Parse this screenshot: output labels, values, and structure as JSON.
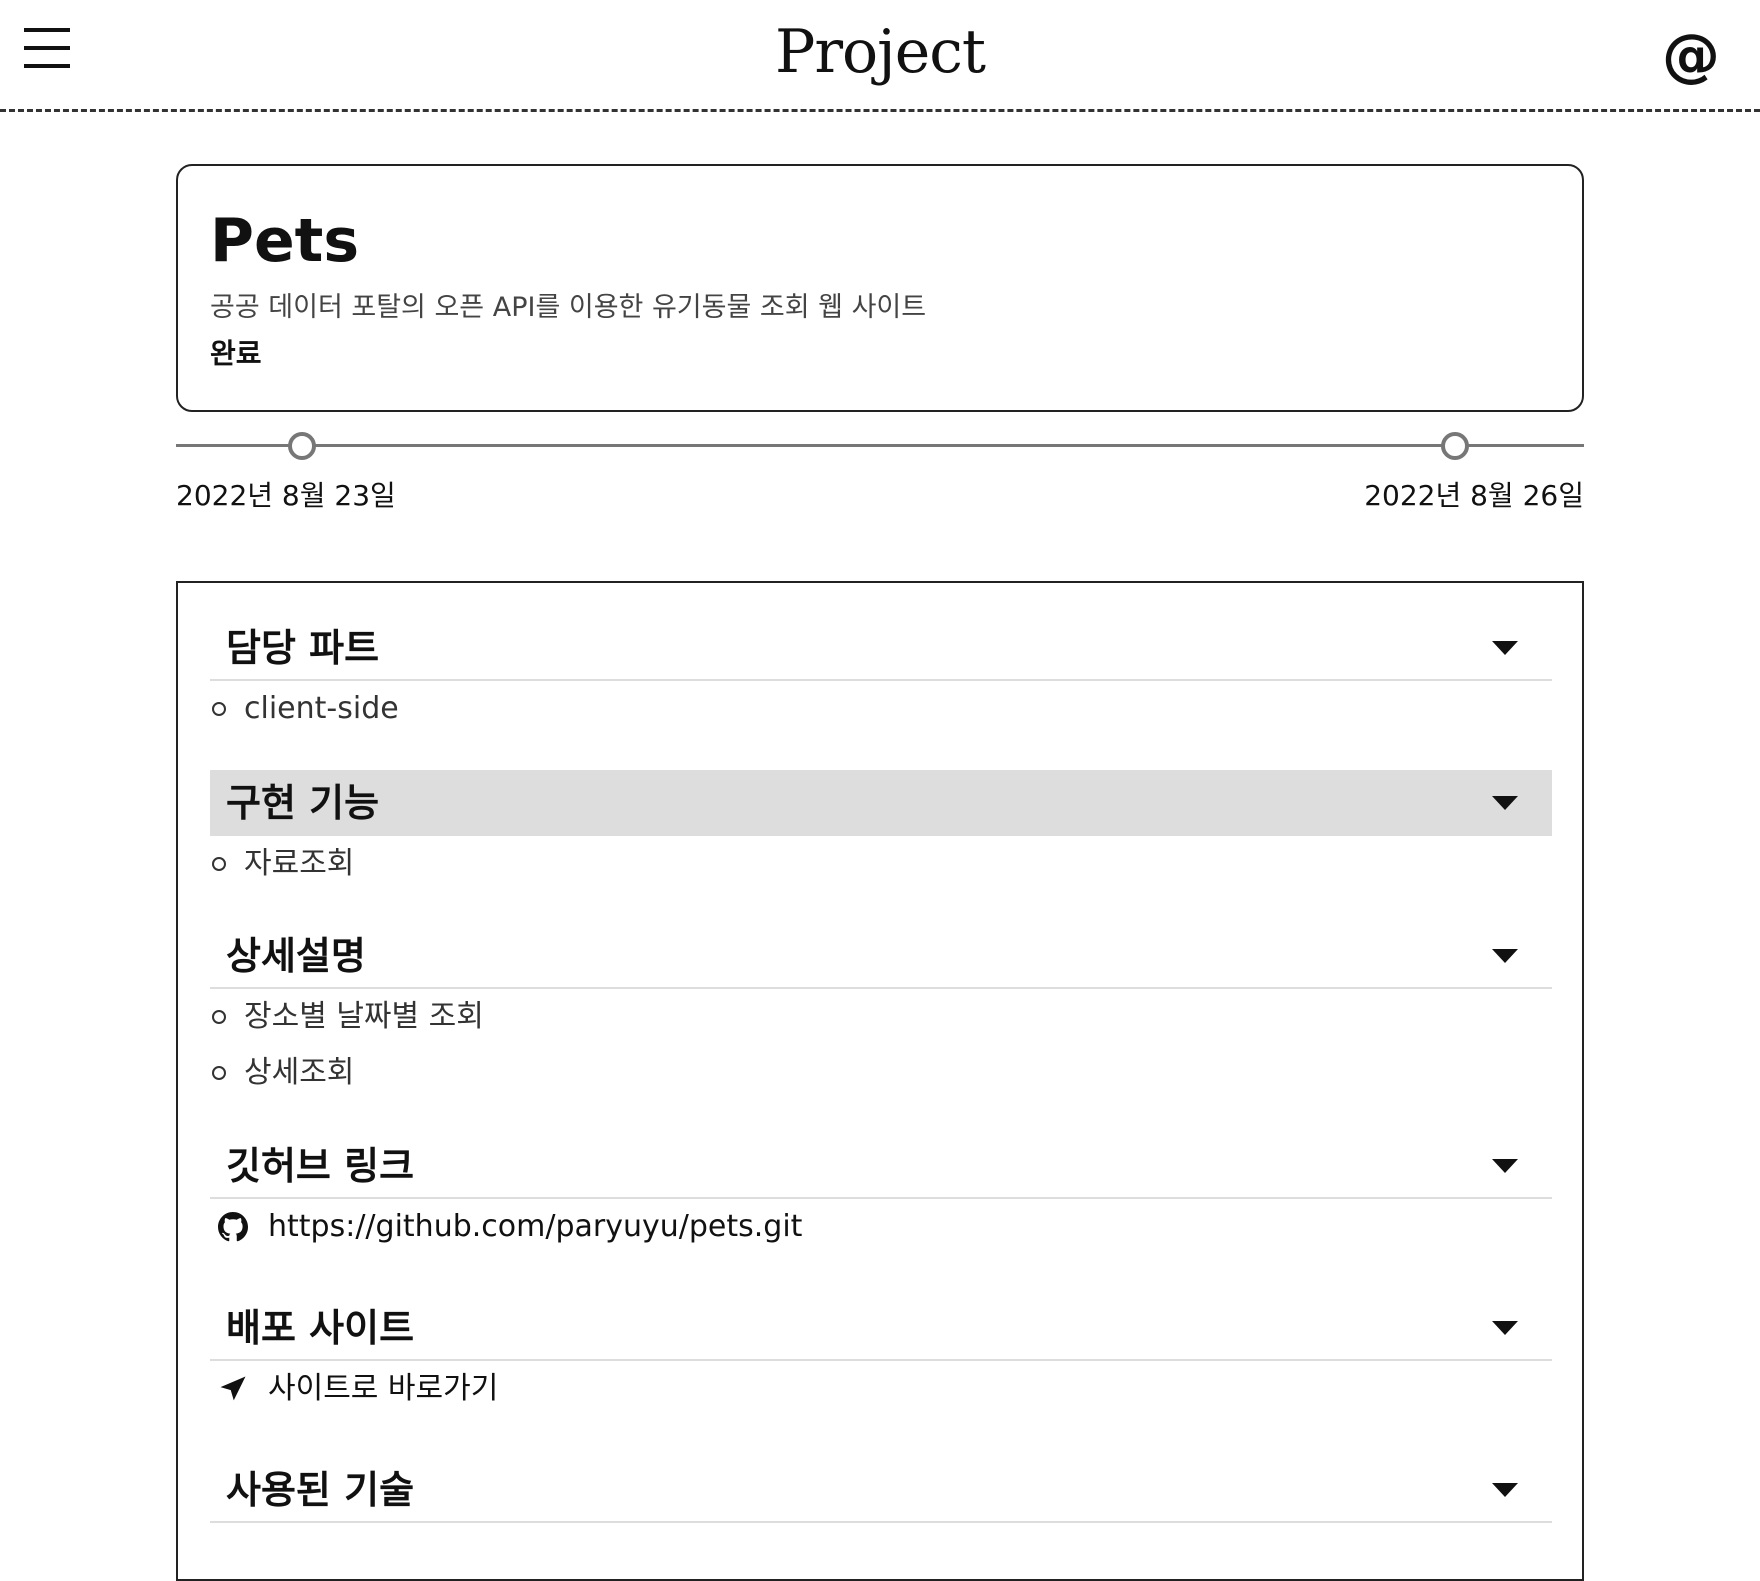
{
  "header": {
    "brand": "Project",
    "contact_icon": "@"
  },
  "project": {
    "title": "Pets",
    "description": "공공 데이터 포탈의 오픈 API를 이용한 유기동물 조회 웹 사이트",
    "status": "완료"
  },
  "timeline": {
    "start": "2022년 8월 23일",
    "end": "2022년 8월 26일"
  },
  "sections": {
    "part": {
      "title": "담당 파트",
      "items": [
        "client-side"
      ]
    },
    "features": {
      "title": "구현 기능",
      "items": [
        "자료조회"
      ]
    },
    "details": {
      "title": "상세설명",
      "items": [
        "장소별 날짜별 조회",
        "상세조회"
      ]
    },
    "github": {
      "title": "깃허브 링크",
      "link": "https://github.com/paryuyu/pets.git"
    },
    "deploy": {
      "title": "배포 사이트",
      "link": "사이트로 바로가기"
    },
    "tech": {
      "title": "사용된 기술"
    }
  },
  "icons": {
    "menu": "menu-icon",
    "contact": "at-icon",
    "caret": "caret-down-icon",
    "bullet": "circle-bullet-icon",
    "github": "github-icon",
    "deploy": "navigation-arrow-icon"
  }
}
